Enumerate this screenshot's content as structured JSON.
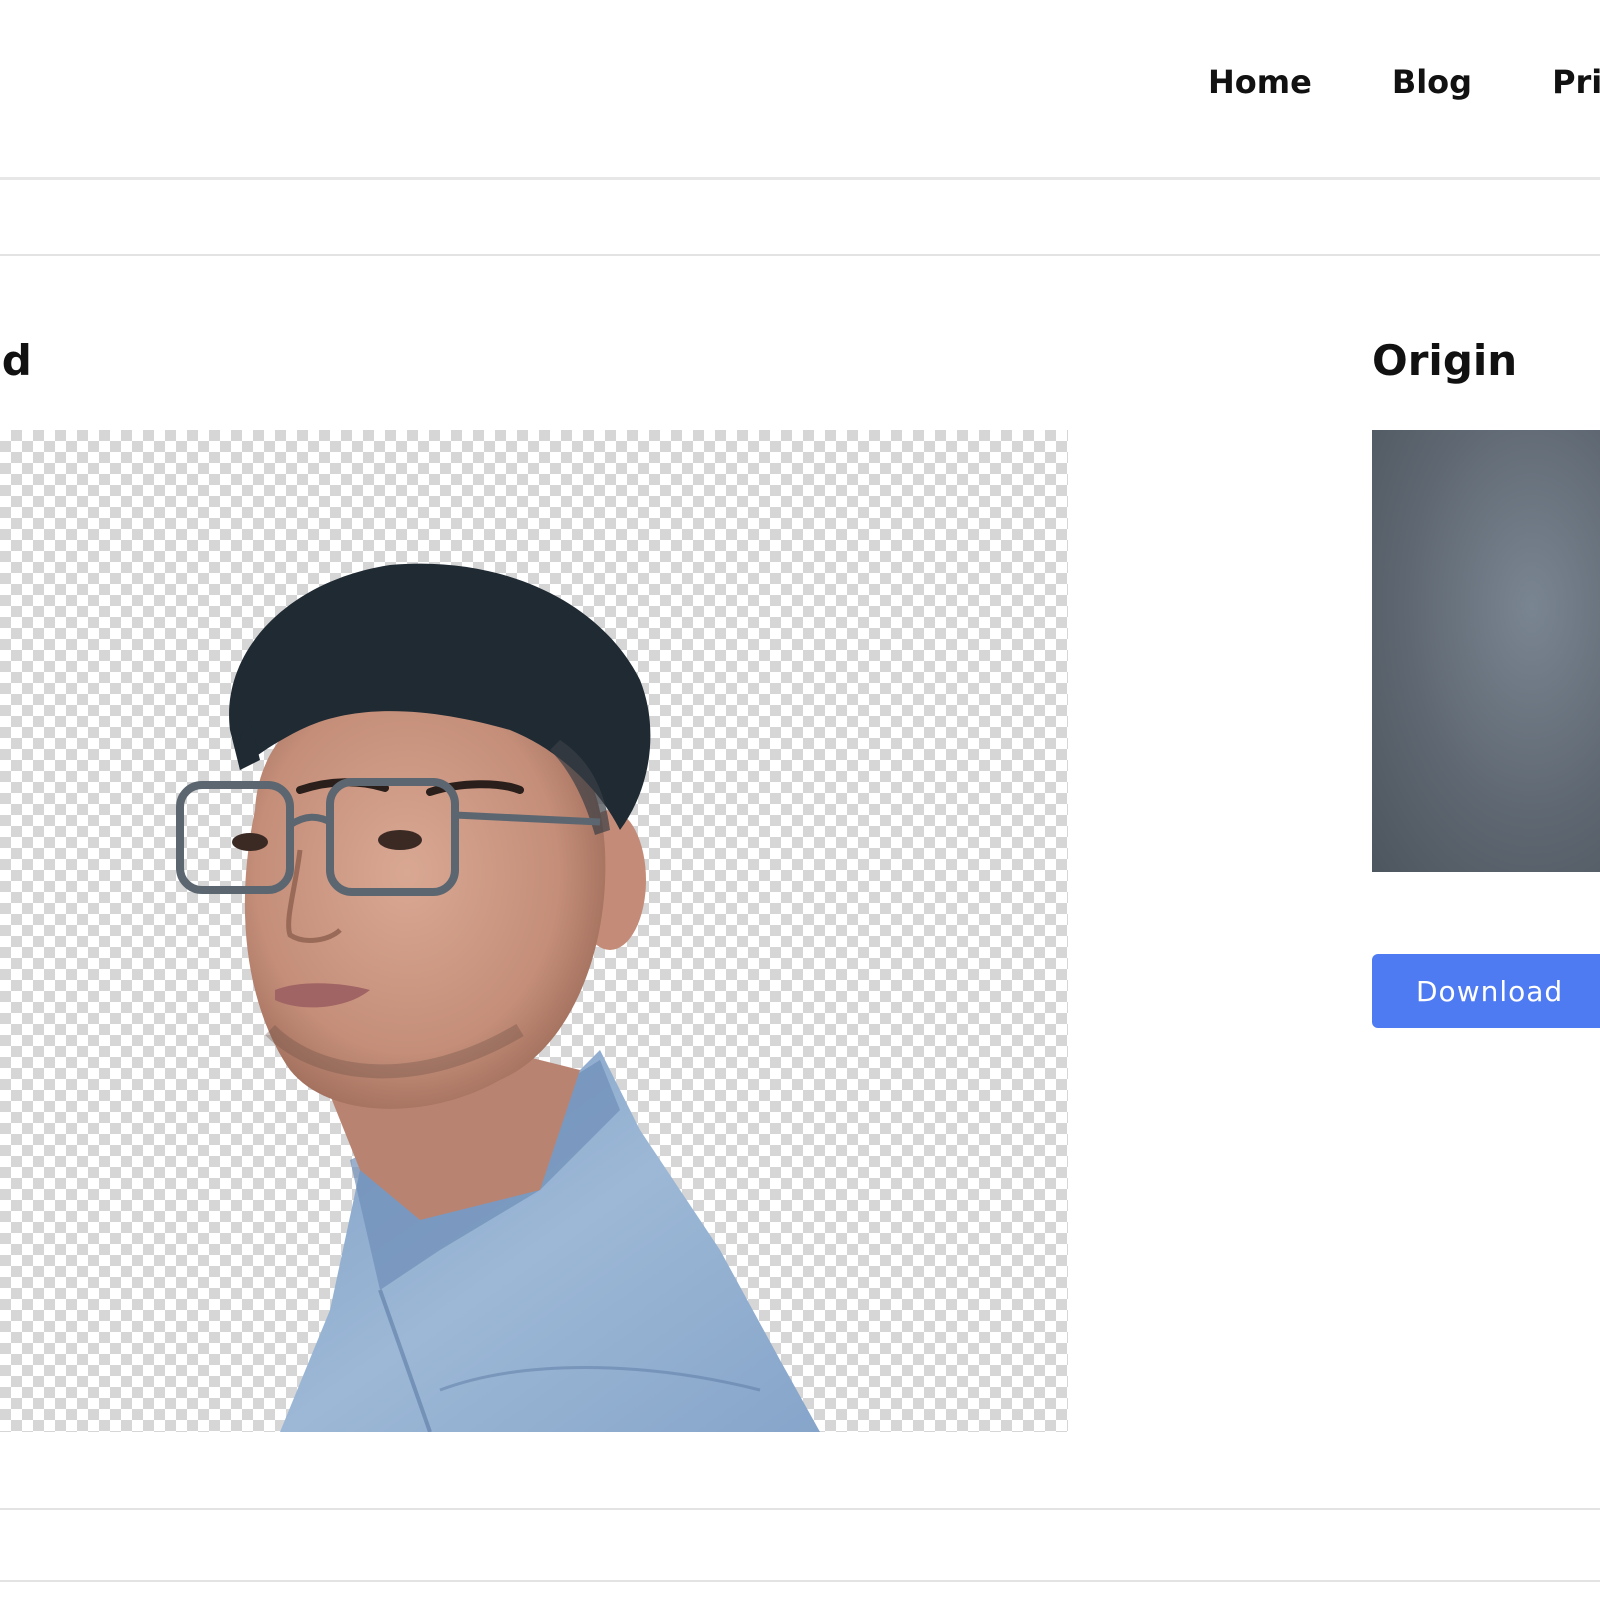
{
  "nav": {
    "items": [
      "Home",
      "Blog",
      "Pri"
    ]
  },
  "result": {
    "title": "und"
  },
  "origin": {
    "title": "Origin"
  },
  "download": {
    "label": "Download"
  },
  "colors": {
    "accent": "#4f7bf2",
    "checker": "#d6d6d6",
    "divider": "#e3e3e3"
  }
}
